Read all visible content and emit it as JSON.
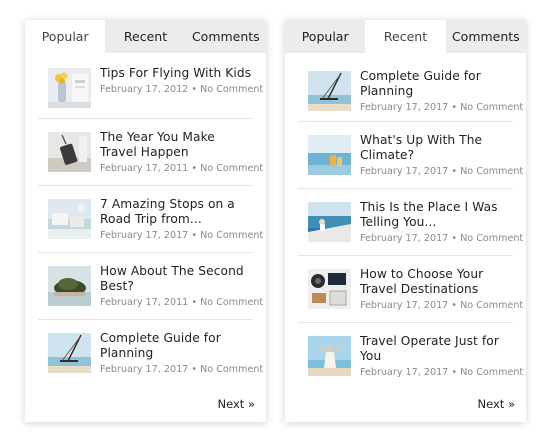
{
  "left_panel": {
    "tabs": [
      {
        "label": "Popular",
        "active": true
      },
      {
        "label": "Recent",
        "active": false
      },
      {
        "label": "Comments",
        "active": false
      }
    ],
    "posts": [
      {
        "title": "Tips For Flying With Kids",
        "date": "February 17, 2012",
        "comments": "No Comment",
        "thumb_icon": "flowers-thumbnail"
      },
      {
        "title": "The Year You Make Travel Happen",
        "date": "February 17, 2011",
        "comments": "No Comment",
        "thumb_icon": "suitcase-thumbnail"
      },
      {
        "title": "7 Amazing Stops on a Road Trip from...",
        "date": "February 17, 2017",
        "comments": "No Comment",
        "thumb_icon": "resort-thumbnail"
      },
      {
        "title": "How About The Second Best?",
        "date": "February 17, 2011",
        "comments": "No Comment",
        "thumb_icon": "island-thumbnail"
      },
      {
        "title": "Complete Guide for Planning",
        "date": "February 17, 2017",
        "comments": "No Comment",
        "thumb_icon": "beach-swing-thumbnail"
      }
    ],
    "next_label": "Next »"
  },
  "right_panel": {
    "tabs": [
      {
        "label": "Popular",
        "active": false
      },
      {
        "label": "Recent",
        "active": true
      },
      {
        "label": "Comments",
        "active": false
      }
    ],
    "posts": [
      {
        "title": "Complete Guide for Planning",
        "date": "February 17, 2017",
        "comments": "No Comment",
        "thumb_icon": "beach-swing-thumbnail"
      },
      {
        "title": "What's Up With The Climate?",
        "date": "February 17, 2017",
        "comments": "No Comment",
        "thumb_icon": "sea-drink-thumbnail"
      },
      {
        "title": "This Is the Place I Was Telling You...",
        "date": "February 17, 2017",
        "comments": "No Comment",
        "thumb_icon": "boat-sea-thumbnail"
      },
      {
        "title": "How to Choose Your Travel Destinations",
        "date": "February 17, 2017",
        "comments": "No Comment",
        "thumb_icon": "travel-gear-thumbnail"
      },
      {
        "title": "Travel Operate Just for You",
        "date": "February 17, 2017",
        "comments": "No Comment",
        "thumb_icon": "woman-beach-thumbnail"
      }
    ],
    "next_label": "Next »"
  },
  "meta_separator": "•"
}
